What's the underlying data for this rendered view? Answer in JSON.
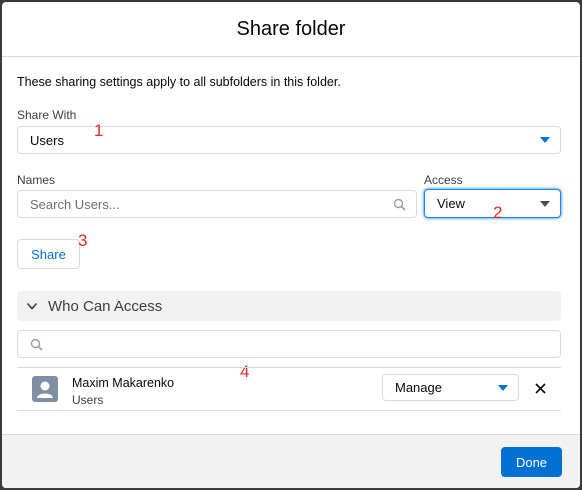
{
  "modal": {
    "title": "Share folder"
  },
  "intro": "These sharing settings apply to all subfolders in this folder.",
  "share_with": {
    "label": "Share With",
    "value": "Users"
  },
  "names": {
    "label": "Names",
    "placeholder": "Search Users..."
  },
  "access": {
    "label": "Access",
    "value": "View"
  },
  "share_button": "Share",
  "who_can_access": {
    "title": "Who Can Access",
    "search_placeholder": "",
    "entries": [
      {
        "name": "Maxim Makarenko",
        "type": "Users",
        "access": "Manage"
      }
    ]
  },
  "done_button": "Done",
  "annotations": [
    "1",
    "2",
    "3",
    "4"
  ],
  "colors": {
    "brand": "#0070d2",
    "annotation": "#e32b2b",
    "border": "#dddbda"
  }
}
